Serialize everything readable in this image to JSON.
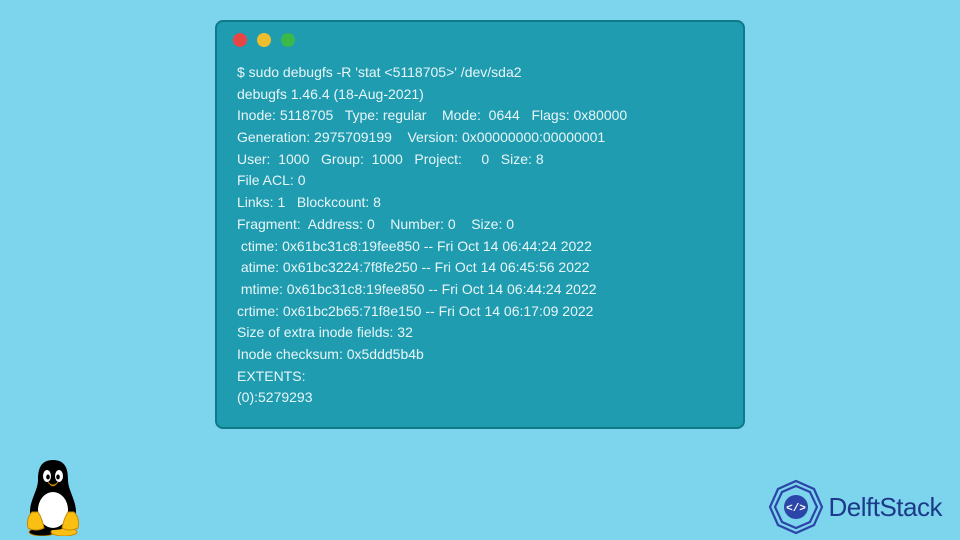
{
  "terminal": {
    "lines": [
      "$ sudo debugfs -R 'stat <5118705>' /dev/sda2",
      "debugfs 1.46.4 (18-Aug-2021)",
      "Inode: 5118705   Type: regular    Mode:  0644   Flags: 0x80000",
      "Generation: 2975709199    Version: 0x00000000:00000001",
      "User:  1000   Group:  1000   Project:     0   Size: 8",
      "File ACL: 0",
      "Links: 1   Blockcount: 8",
      "Fragment:  Address: 0    Number: 0    Size: 0",
      " ctime: 0x61bc31c8:19fee850 -- Fri Oct 14 06:44:24 2022",
      " atime: 0x61bc3224:7f8fe250 -- Fri Oct 14 06:45:56 2022",
      " mtime: 0x61bc31c8:19fee850 -- Fri Oct 14 06:44:24 2022",
      "crtime: 0x61bc2b65:71f8e150 -- Fri Oct 14 06:17:09 2022",
      "Size of extra inode fields: 32",
      "Inode checksum: 0x5ddd5b4b",
      "EXTENTS:",
      "(0):5279293"
    ]
  },
  "brand": {
    "name": "DelftStack"
  }
}
